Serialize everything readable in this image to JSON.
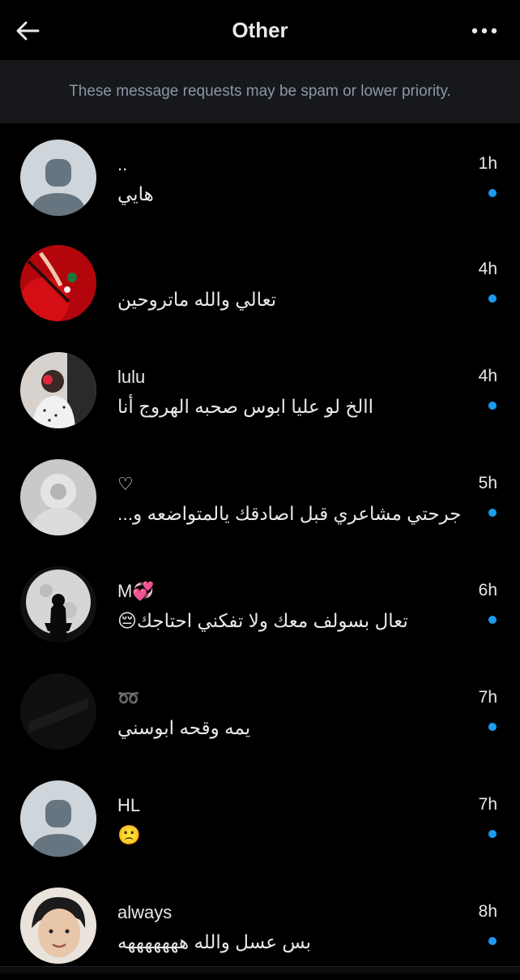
{
  "header": {
    "title": "Other",
    "back_icon": "arrow-left-icon",
    "more_icon": "more-horizontal-icon"
  },
  "notice": {
    "text": "These message requests may be spam or lower priority."
  },
  "conversations": [
    {
      "name": "..",
      "message": "هايي",
      "time": "1h",
      "unread": true,
      "avatar": "default-avatar"
    },
    {
      "name": "",
      "message": "تعالي والله ماتروحين",
      "time": "4h",
      "unread": true,
      "avatar": "photo-red"
    },
    {
      "name": "lulu",
      "message": "االخ لو عليا ابوس صحبه الهروج أنا",
      "time": "4h",
      "unread": true,
      "avatar": "photo-person"
    },
    {
      "name": "♡",
      "message": "جرحتي مشاعري قبل اصادقك يالمتواضعه و...",
      "time": "5h",
      "unread": true,
      "avatar": "photo-faded"
    },
    {
      "name": "M💞",
      "message": "تعال بسولف معك ولا تفكني احتاجك😔",
      "time": "6h",
      "unread": true,
      "avatar": "photo-moon"
    },
    {
      "name": "➿",
      "message": "يمه وقحه ابوسني",
      "time": "7h",
      "unread": true,
      "avatar": "photo-dark"
    },
    {
      "name": "HL",
      "message": "🙁",
      "time": "7h",
      "unread": true,
      "avatar": "default-avatar"
    },
    {
      "name": "always",
      "message": "بس عسل والله هههههههه",
      "time": "8h",
      "unread": true,
      "avatar": "photo-face"
    }
  ],
  "colors": {
    "accent": "#1d9bf0",
    "background": "#000000",
    "notice_bg": "#16181c",
    "muted": "#8b98a5"
  }
}
